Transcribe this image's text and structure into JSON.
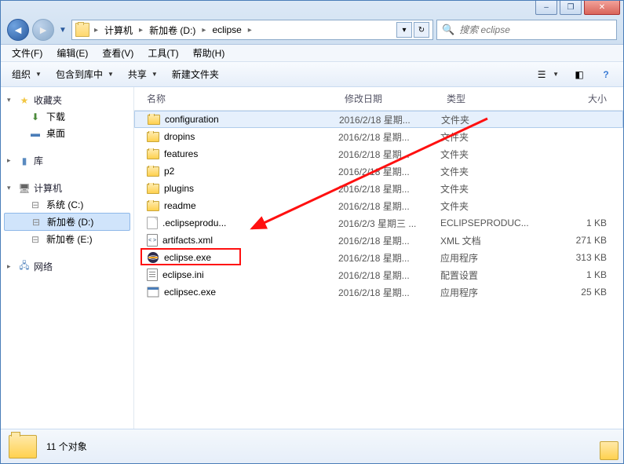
{
  "window": {
    "min_label": "–",
    "max_label": "❐",
    "close_label": "✕"
  },
  "breadcrumbs": [
    "计算机",
    "新加卷 (D:)",
    "eclipse"
  ],
  "search_placeholder": "搜索 eclipse",
  "menu": [
    {
      "label": "文件(F)"
    },
    {
      "label": "编辑(E)"
    },
    {
      "label": "查看(V)"
    },
    {
      "label": "工具(T)"
    },
    {
      "label": "帮助(H)"
    }
  ],
  "toolbar": {
    "organize": "组织",
    "include": "包含到库中",
    "share": "共享",
    "newfolder": "新建文件夹"
  },
  "sidebar": {
    "favorites": {
      "label": "收藏夹",
      "items": [
        {
          "label": "下载",
          "icon": "download"
        },
        {
          "label": "桌面",
          "icon": "desktop"
        }
      ]
    },
    "libraries": {
      "label": "库"
    },
    "computer": {
      "label": "计算机",
      "items": [
        {
          "label": "系统 (C:)",
          "icon": "drive-c"
        },
        {
          "label": "新加卷 (D:)",
          "icon": "drive-d",
          "selected": true
        },
        {
          "label": "新加卷 (E:)",
          "icon": "drive-e"
        }
      ]
    },
    "network": {
      "label": "网络"
    }
  },
  "columns": {
    "name": "名称",
    "date": "修改日期",
    "type": "类型",
    "size": "大小"
  },
  "files": [
    {
      "name": "configuration",
      "date": "2016/2/18 星期...",
      "type": "文件夹",
      "size": "",
      "icon": "folder",
      "selected": true
    },
    {
      "name": "dropins",
      "date": "2016/2/18 星期...",
      "type": "文件夹",
      "size": "",
      "icon": "folder"
    },
    {
      "name": "features",
      "date": "2016/2/18 星期...",
      "type": "文件夹",
      "size": "",
      "icon": "folder"
    },
    {
      "name": "p2",
      "date": "2016/2/18 星期...",
      "type": "文件夹",
      "size": "",
      "icon": "folder"
    },
    {
      "name": "plugins",
      "date": "2016/2/18 星期...",
      "type": "文件夹",
      "size": "",
      "icon": "folder"
    },
    {
      "name": "readme",
      "date": "2016/2/18 星期...",
      "type": "文件夹",
      "size": "",
      "icon": "folder"
    },
    {
      "name": ".eclipseprodu...",
      "date": "2016/2/3 星期三 ...",
      "type": "ECLIPSEPRODUC...",
      "size": "1 KB",
      "icon": "file"
    },
    {
      "name": "artifacts.xml",
      "date": "2016/2/18 星期...",
      "type": "XML 文档",
      "size": "271 KB",
      "icon": "xml"
    },
    {
      "name": "eclipse.exe",
      "date": "2016/2/18 星期...",
      "type": "应用程序",
      "size": "313 KB",
      "icon": "eclipse",
      "highlighted": true
    },
    {
      "name": "eclipse.ini",
      "date": "2016/2/18 星期...",
      "type": "配置设置",
      "size": "1 KB",
      "icon": "ini"
    },
    {
      "name": "eclipsec.exe",
      "date": "2016/2/18 星期...",
      "type": "应用程序",
      "size": "25 KB",
      "icon": "exe"
    }
  ],
  "status": {
    "count": "11 个对象"
  }
}
